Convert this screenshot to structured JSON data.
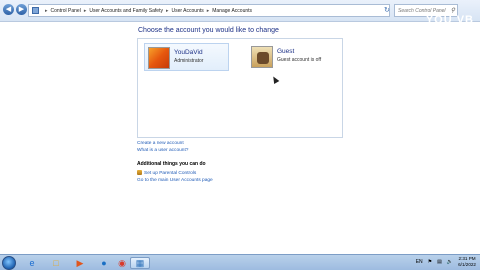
{
  "addressbar": {
    "breadcrumbs": [
      "Control Panel",
      "User Accounts and Family Safety",
      "User Accounts",
      "Manage Accounts"
    ],
    "search_placeholder": "Search Control Panel"
  },
  "watermark": "YOU VB",
  "main": {
    "heading": "Choose the account you would like to change",
    "accounts": [
      {
        "name": "YouDaVid",
        "role": "Administrator"
      },
      {
        "name": "Guest",
        "role": "Guest account is off"
      }
    ],
    "links": [
      "Create a new account",
      "What is a user account?"
    ],
    "additional_heading": "Additional things you can do",
    "additional_links": [
      "Set up Parental Controls",
      "Go to the main User Accounts page"
    ]
  },
  "taskbar": {
    "icons": [
      "ie-icon",
      "folder-icon",
      "media-player-icon",
      "chrome-icon",
      "control-panel-icon"
    ],
    "language": "EN",
    "time": "2:31 PM",
    "date": "6/1/2022"
  }
}
